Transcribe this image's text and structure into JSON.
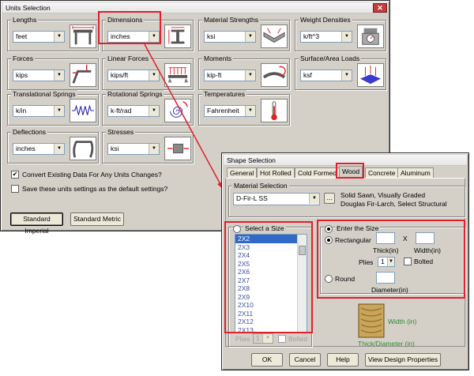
{
  "units": {
    "title": "Units Selection",
    "close_glyph": "✕",
    "groups": {
      "lengths": {
        "label": "Lengths",
        "value": "feet",
        "icon": "beam-frame-icon"
      },
      "dimensions": {
        "label": "Dimensions",
        "value": "inches",
        "icon": "dimension-section-icon"
      },
      "material_strengths": {
        "label": "Material Strengths",
        "value": "ksi",
        "icon": "stress-beam-icon"
      },
      "weight_densities": {
        "label": "Weight Densities",
        "value": "k/ft^3",
        "icon": "scale-icon"
      },
      "forces": {
        "label": "Forces",
        "value": "kips",
        "icon": "force-frame-icon"
      },
      "linear_forces": {
        "label": "Linear Forces",
        "value": "kips/ft",
        "icon": "distributed-load-icon"
      },
      "moments": {
        "label": "Moments",
        "value": "kip-ft",
        "icon": "moment-icon"
      },
      "surface_area_loads": {
        "label": "Surface/Area Loads",
        "value": "ksf",
        "icon": "area-load-icon"
      },
      "translational_springs": {
        "label": "Translational Springs",
        "value": "k/in",
        "icon": "spring-icon"
      },
      "rotational_springs": {
        "label": "Rotational Springs",
        "value": "k-ft/rad",
        "icon": "rotational-spring-icon"
      },
      "temperatures": {
        "label": "Temperatures",
        "value": "Fahrenheit",
        "icon": "thermometer-icon"
      },
      "deflections": {
        "label": "Deflections",
        "value": "inches",
        "icon": "deflected-frame-icon"
      },
      "stresses": {
        "label": "Stresses",
        "value": "ksi",
        "icon": "stress-element-icon"
      }
    },
    "convert_label": "Convert Existing Data For Any Units Changes?",
    "save_label": "Save these units settings as the default settings?",
    "standard_imperial": "Standard Imperial",
    "standard_metric": "Standard Metric"
  },
  "shape": {
    "title": "Shape Selection",
    "tabs": [
      "General",
      "Hot Rolled",
      "Cold Formed",
      "Wood",
      "Concrete",
      "Aluminum"
    ],
    "active_tab": "Wood",
    "material_label": "Material Selection",
    "material_value": "D-Fir-L SS",
    "browse_label": "...",
    "material_desc_1": "Solid Sawn, Visually Graded",
    "material_desc_2": "Douglas Fir-Larch, Select Structural",
    "select_size_label": "Select a Size",
    "sizes": [
      "2X2",
      "2X3",
      "2X4",
      "2X5",
      "2X6",
      "2X7",
      "2X8",
      "2X9",
      "2X10",
      "2X11",
      "2X12",
      "2X13"
    ],
    "selected_size": "2X2",
    "plies_label": "Plies",
    "plies_value": "1",
    "bolted_label": "Bolted",
    "enter_size_label": "Enter the Size",
    "rectangular_label": "Rectangular",
    "x_label": "X",
    "thick_label": "Thick(in)",
    "width_label": "Width(in)",
    "round_label": "Round",
    "diameter_label": "Diameter(in)",
    "width_legend": "Width (in)",
    "thick_legend": "Thick/Diameter (in)",
    "ok": "OK",
    "cancel": "Cancel",
    "help": "Help",
    "view_props": "View Design Properties"
  },
  "colors": {
    "highlight": "#e0202c",
    "legend_green": "#2e8b2e"
  }
}
